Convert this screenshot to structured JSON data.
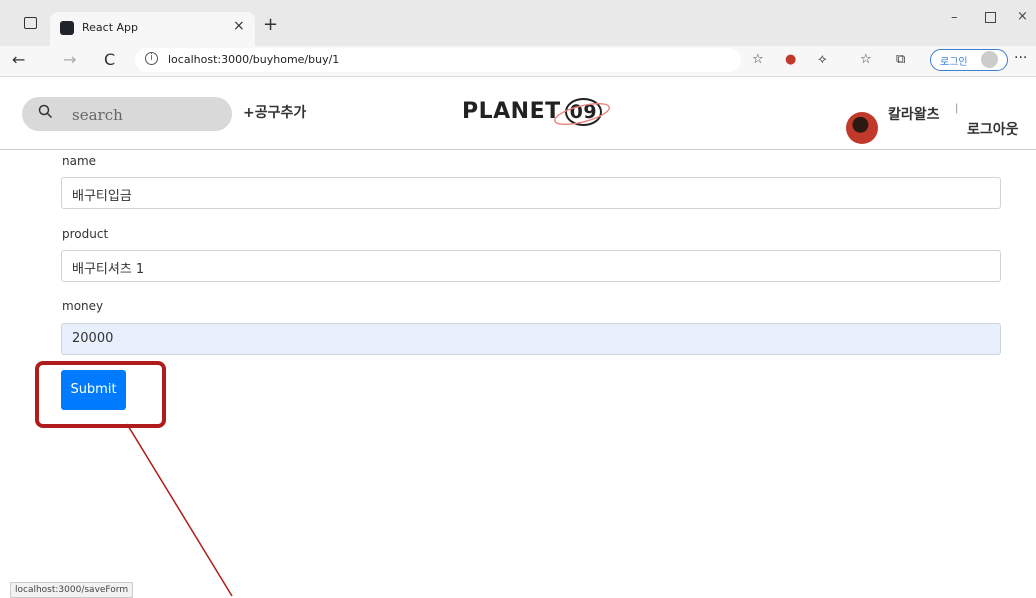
{
  "browser": {
    "tab_title": "React App",
    "tab_close": "×",
    "new_tab": "+",
    "url": "localhost:3000/buyhome/buy/1",
    "profile_label": "로그인",
    "window_controls": {
      "minimize": "–",
      "close": "×"
    },
    "nav": {
      "back": "←",
      "forward": "→",
      "reload": "C"
    },
    "status_url": "localhost:3000/saveForm"
  },
  "header": {
    "search_placeholder": "search",
    "add_group_buy": "+공구추가",
    "logo": "PLANET",
    "logo_suffix": "09",
    "user_name": "칼라왈츠",
    "user_separator": "|",
    "logout": "로그아웃"
  },
  "form": {
    "name_label": "name",
    "name_value": "배구티입금",
    "product_label": "product",
    "product_value": "배구티셔츠 1",
    "money_label": "money",
    "money_value": "20000",
    "submit_label": "Submit"
  },
  "colors": {
    "submit": "#007bff",
    "annotation": "#b01c1c",
    "autofill": "#e8f0fe"
  }
}
